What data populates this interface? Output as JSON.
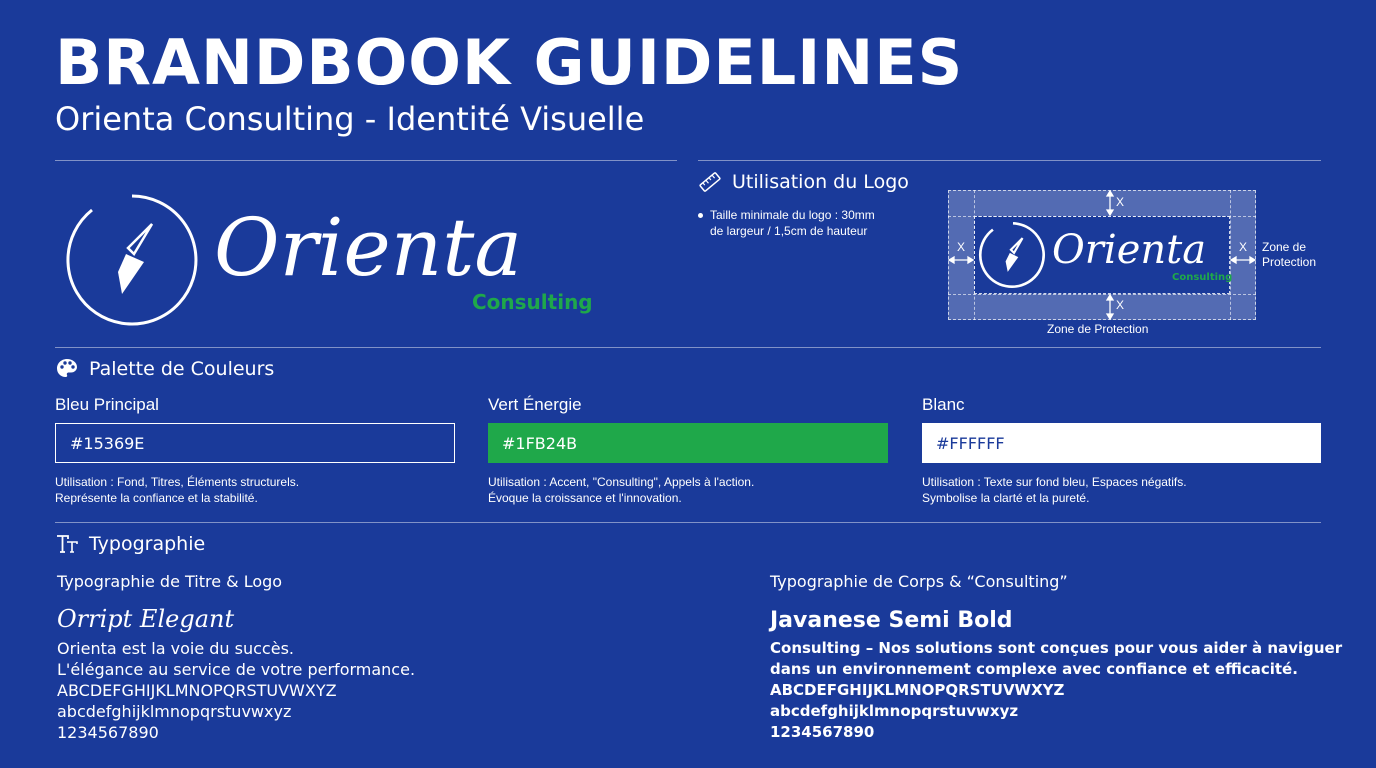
{
  "header": {
    "title": "BRANDBOOK GUIDELINES",
    "subtitle": "Orienta Consulting - Identité Visuelle"
  },
  "logo": {
    "wordmark": "Orienta",
    "tagline": "Consulting",
    "icon": "compass-arrow-icon"
  },
  "logo_usage": {
    "title": "Utilisation du Logo",
    "icon": "ruler-icon",
    "bullet": "Taille minimale du logo : 30mm de largeur / 1,5cm de hauteur",
    "diagram": {
      "margin_label": "X",
      "side_label": "Zone de Protection",
      "bottom_label": "Zone de Protection",
      "wordmark": "Orienta",
      "tagline": "Consulting"
    }
  },
  "palette": {
    "title": "Palette de Couleurs",
    "icon": "palette-icon",
    "colors": [
      {
        "name": "Bleu Principal",
        "hex": "#15369E",
        "swatch": "#1a3a9a",
        "usage1": "Utilisation : Fond, Titres, Éléments structurels.",
        "usage2": "Représente la confiance et la stabilité."
      },
      {
        "name": "Vert Énergie",
        "hex": "#1FB24B",
        "swatch": "#1fa84a",
        "usage1": "Utilisation : Accent, \"Consulting\", Appels à l'action.",
        "usage2": "Évoque la croissance et l'innovation."
      },
      {
        "name": "Blanc",
        "hex": "#FFFFFF",
        "swatch": "#ffffff",
        "usage1": "Utilisation : Texte sur fond bleu, Espaces négatifs.",
        "usage2": "Symbolise la clarté et la pureté."
      }
    ]
  },
  "typography": {
    "title": "Typographie",
    "icon": "text-type-icon",
    "title_font": {
      "heading": "Typographie de Titre & Logo",
      "name": "Orript Elegant",
      "lines": [
        "Orienta est la voie du succès.",
        "L'élégance au service de votre performance.",
        "ABCDEFGHIJKLMNOPQRSTUVWXYZ",
        "abcdefghijklmnopqrstuvwxyz",
        "1234567890"
      ]
    },
    "body_font": {
      "heading": "Typographie de Corps & “Consulting”",
      "name": "Javanese Semi Bold",
      "lines": [
        "Consulting – Nos solutions sont conçues pour vous aider à naviguer",
        "dans un environnement complexe avec confiance et efficacité.",
        "ABCDEFGHIJKLMNOPQRSTUVWXYZ",
        "abcdefghijklmnopqrstuvwxyz",
        "1234567890"
      ]
    }
  },
  "colors": {
    "background": "#1a3a9a",
    "accent_green": "#1fa84a",
    "white": "#ffffff"
  }
}
